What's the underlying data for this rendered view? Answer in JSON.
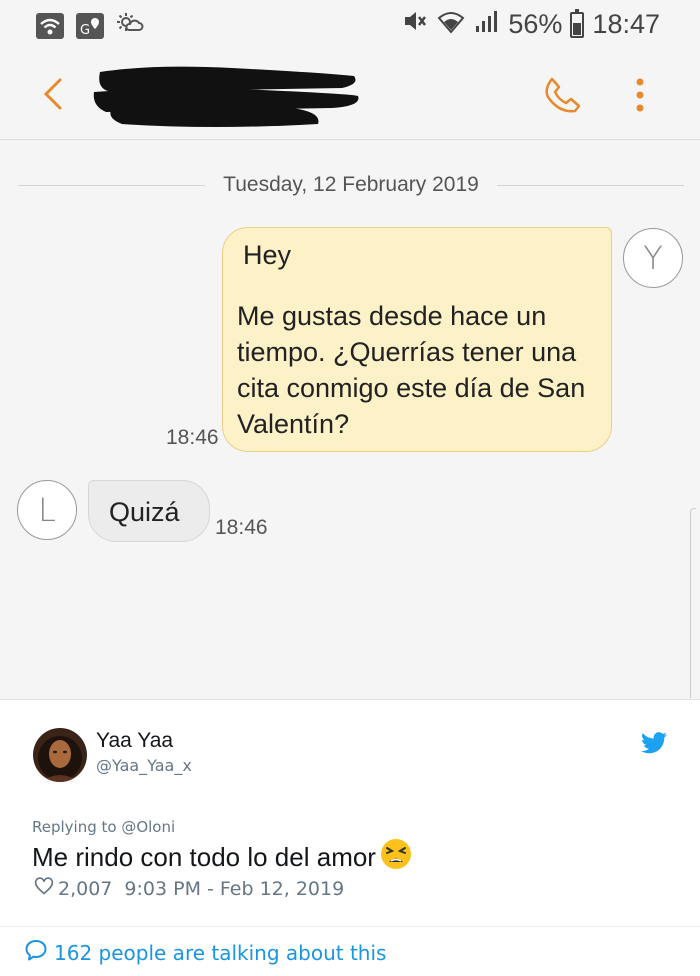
{
  "status_bar": {
    "battery": "56%",
    "time": "18:47"
  },
  "conversation": {
    "date_divider": "Tuesday, 12 February 2019",
    "outgoing": {
      "greeting": "Hey",
      "body": "Me gustas desde hace  un tiempo. ¿Querrías tener una cita conmigo  este  día de San Valentín?",
      "time": "18:46",
      "avatar_letter": "Y",
      "bubble_color": "#fdf1c7"
    },
    "incoming": {
      "text": "Quizá",
      "time": "18:46",
      "avatar_letter": "L",
      "bubble_color": "#ececec"
    },
    "accent_color": "#e8892c"
  },
  "tweet": {
    "display_name": "Yaa Yaa",
    "handle": "@Yaa_Yaa_x",
    "replying_to": "Replying to @Oloni",
    "text": "Me rindo con todo lo del amor",
    "emoji": "tired-face-emoji",
    "likes": "2,007",
    "timestamp": "9:03 PM - Feb 12, 2019",
    "talking": "162 people are talking about this",
    "link_color": "#1b95e0"
  }
}
